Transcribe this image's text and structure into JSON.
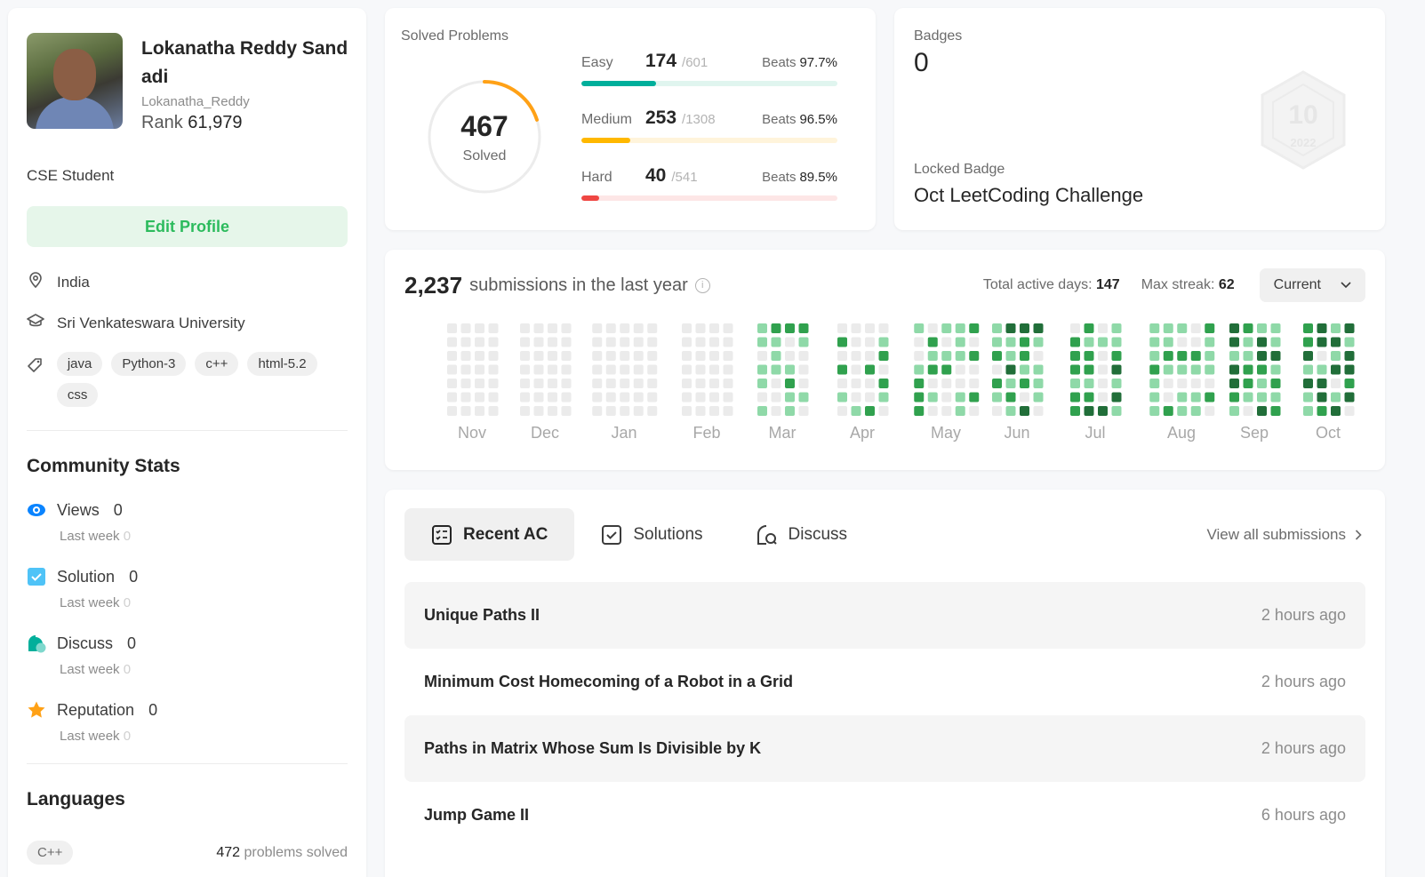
{
  "profile": {
    "name": "Lokanatha Reddy Sandadi",
    "username": "Lokanatha_Reddy",
    "rank_label": "Rank",
    "rank": "61,979",
    "bio": "CSE Student",
    "edit_label": "Edit Profile",
    "location": "India",
    "university": "Sri Venkateswara University",
    "skills": [
      "java",
      "Python-3",
      "c++",
      "html-5.2",
      "css"
    ]
  },
  "community": {
    "title": "Community Stats",
    "lastweek_label": "Last week",
    "stats": [
      {
        "label": "Views",
        "value": "0",
        "lastweek": "0",
        "icon": "eye-icon",
        "color": "#0a84ff"
      },
      {
        "label": "Solution",
        "value": "0",
        "lastweek": "0",
        "icon": "checkbox-icon",
        "color": "#4fc3f7"
      },
      {
        "label": "Discuss",
        "value": "0",
        "lastweek": "0",
        "icon": "chat-icon",
        "color": "#00af9b"
      },
      {
        "label": "Reputation",
        "value": "0",
        "lastweek": "0",
        "icon": "star-icon",
        "color": "#ffa116"
      }
    ]
  },
  "languages": {
    "title": "Languages",
    "items": [
      {
        "name": "C++",
        "count": "472",
        "suffix": "problems solved"
      }
    ]
  },
  "solved": {
    "title": "Solved Problems",
    "total": "467",
    "total_label": "Solved",
    "ring_fraction": 0.2,
    "difficulties": [
      {
        "label": "Easy",
        "solved": "174",
        "total": "/601",
        "beats_label": "Beats",
        "beats": "97.7%",
        "fraction": 0.29,
        "color": "#00af9b",
        "track": "#e0f5ef"
      },
      {
        "label": "Medium",
        "solved": "253",
        "total": "/1308",
        "beats_label": "Beats",
        "beats": "96.5%",
        "fraction": 0.19,
        "color": "#ffb800",
        "track": "#fff4db"
      },
      {
        "label": "Hard",
        "solved": "40",
        "total": "/541",
        "beats_label": "Beats",
        "beats": "89.5%",
        "fraction": 0.07,
        "color": "#ef4743",
        "track": "#fde6e6"
      }
    ]
  },
  "badges": {
    "title": "Badges",
    "count": "0",
    "locked_label": "Locked Badge",
    "locked_name": "Oct LeetCoding Challenge",
    "badge_icon": "hexagon-badge-icon",
    "badge_text": "10",
    "badge_year": "2022"
  },
  "heatmap": {
    "total": "2,237",
    "label": "submissions in the last year",
    "active_label": "Total active days:",
    "active": "147",
    "streak_label": "Max streak:",
    "streak": "62",
    "dropdown": "Current",
    "months": [
      "Nov",
      "Dec",
      "Jan",
      "Feb",
      "Mar",
      "Apr",
      "May",
      "Jun",
      "Jul",
      "Aug",
      "Sep",
      "Oct"
    ],
    "colors": [
      "#ebebeb",
      "#8fd9a8",
      "#30a14e",
      "#216e39",
      "#1b5e33"
    ]
  },
  "tabs": {
    "items": [
      {
        "label": "Recent AC",
        "icon": "list-icon"
      },
      {
        "label": "Solutions",
        "icon": "checkbox-icon"
      },
      {
        "label": "Discuss",
        "icon": "chat-icon"
      }
    ],
    "view_all": "View all submissions"
  },
  "recent": [
    {
      "title": "Unique Paths II",
      "time": "2 hours ago"
    },
    {
      "title": "Minimum Cost Homecoming of a Robot in a Grid",
      "time": "2 hours ago"
    },
    {
      "title": "Paths in Matrix Whose Sum Is Divisible by K",
      "time": "2 hours ago"
    },
    {
      "title": "Jump Game II",
      "time": "6 hours ago"
    }
  ]
}
